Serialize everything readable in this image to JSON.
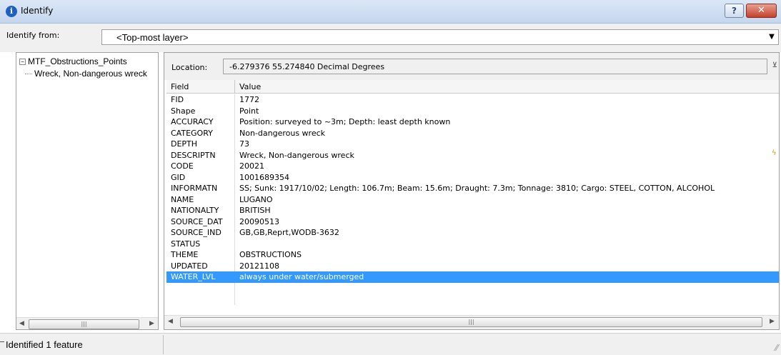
{
  "window": {
    "title": "Identify",
    "help_label": "?",
    "close_label": "✕"
  },
  "identify_from": {
    "label": "Identify from:",
    "value": "<Top-most layer>"
  },
  "tree": {
    "root_label": "MTF_Obstructions_Points",
    "child_label": "Wreck, Non-dangerous wreck"
  },
  "location": {
    "label": "Location:",
    "value": "-6.279376  55.274840 Decimal Degrees"
  },
  "grid": {
    "headers": {
      "field": "Field",
      "value": "Value"
    },
    "rows": [
      {
        "field": "FID",
        "value": "1772"
      },
      {
        "field": "Shape",
        "value": "Point"
      },
      {
        "field": "ACCURACY",
        "value": "Position: surveyed to ~3m; Depth: least depth known"
      },
      {
        "field": "CATEGORY",
        "value": "Non-dangerous wreck"
      },
      {
        "field": "DEPTH",
        "value": "73"
      },
      {
        "field": "DESCRIPTN",
        "value": "Wreck, Non-dangerous wreck"
      },
      {
        "field": "CODE",
        "value": "20021"
      },
      {
        "field": "GID",
        "value": "1001689354"
      },
      {
        "field": "INFORMATN",
        "value": "SS; Sunk: 1917/10/02; Length: 106.7m; Beam: 15.6m; Draught: 7.3m; Tonnage: 3810; Cargo: STEEL, COTTON, ALCOHOL"
      },
      {
        "field": "NAME",
        "value": "LUGANO"
      },
      {
        "field": "NATIONALTY",
        "value": "BRITISH"
      },
      {
        "field": "SOURCE_DAT",
        "value": "20090513"
      },
      {
        "field": "SOURCE_IND",
        "value": "GB,GB,Reprt,WODB-3632"
      },
      {
        "field": "STATUS",
        "value": ""
      },
      {
        "field": "THEME",
        "value": "OBSTRUCTIONS"
      },
      {
        "field": "UPDATED",
        "value": "20121108"
      },
      {
        "field": "WATER_LVL",
        "value": "always under water/submerged"
      }
    ],
    "selected_field": "WATER_LVL"
  },
  "status": {
    "text": "Identified 1 feature"
  },
  "icons": {
    "title": "info-icon",
    "hyperlink": "lightning-icon",
    "colors": {
      "selection": "#3399ff",
      "title_icon": "#1e5fc5",
      "close": "#c5412a"
    }
  }
}
